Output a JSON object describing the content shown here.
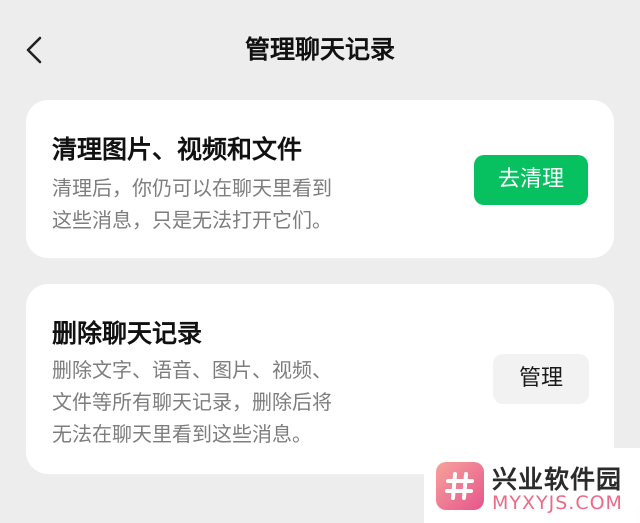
{
  "nav": {
    "title": "管理聊天记录",
    "back_icon": "chevron-left-icon"
  },
  "media_card": {
    "title": "清理图片、视频和文件",
    "description_lines": [
      "清理后，你仍可以在聊天里看到",
      "这些消息，只是无法打开它们。"
    ],
    "button_label": "去清理",
    "button_color": "#07c160"
  },
  "history_card": {
    "title": "删除聊天记录",
    "description_lines": [
      "删除文字、语音、图片、视频、",
      "文件等所有聊天记录，删除后将",
      "无法在聊天里看到这些消息。"
    ],
    "button_label": "管理"
  },
  "watermark": {
    "name": "兴业软件园",
    "domain": "MYXYJS.COM",
    "icon": "hash-logo-icon"
  },
  "colors": {
    "background": "#ededed",
    "card": "#ffffff",
    "accent_green": "#07c160",
    "secondary_text": "#7d7d7d"
  }
}
